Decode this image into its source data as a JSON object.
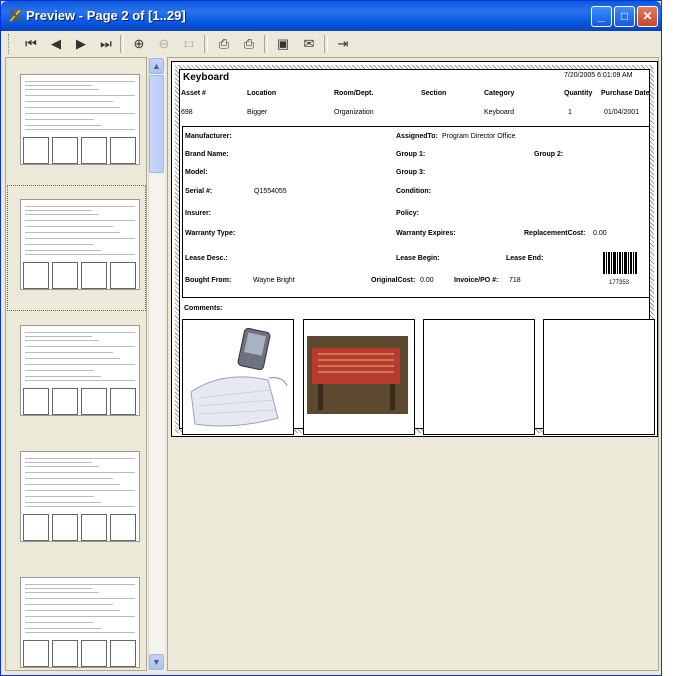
{
  "window": {
    "title": "Preview - Page 2 of [1..29]"
  },
  "toolbar": {
    "buttons": [
      {
        "name": "first-page-icon",
        "glyph": "⏮",
        "enabled": true
      },
      {
        "name": "prev-page-icon",
        "glyph": "◀",
        "enabled": true
      },
      {
        "name": "next-page-icon",
        "glyph": "▶",
        "enabled": true
      },
      {
        "name": "last-page-icon",
        "glyph": "⏭",
        "enabled": true
      },
      {
        "name": "zoom-in-icon",
        "glyph": "⊕",
        "enabled": true
      },
      {
        "name": "zoom-out-icon",
        "glyph": "⊖",
        "enabled": false
      },
      {
        "name": "actual-size-icon",
        "glyph": "1:1",
        "enabled": false
      },
      {
        "name": "print-icon",
        "glyph": "⎙",
        "enabled": true
      },
      {
        "name": "print-setup-icon",
        "glyph": "⎙",
        "enabled": true
      },
      {
        "name": "save-icon",
        "glyph": "▣",
        "enabled": true
      },
      {
        "name": "email-icon",
        "glyph": "✉",
        "enabled": true
      },
      {
        "name": "exit-icon",
        "glyph": "⇥",
        "enabled": true
      }
    ]
  },
  "report": {
    "asset_type": "Keyboard",
    "timestamp": "7/20/2005 6:01:09 AM",
    "columns": [
      "Asset #",
      "Location",
      "Room/Dept.",
      "Section",
      "Category",
      "Quantity",
      "Purchase Date"
    ],
    "row": [
      "698",
      "Bigger",
      "Organization",
      "",
      "Keyboard",
      "1",
      "01/04/2001"
    ],
    "labels": {
      "manufacturer": "Manufacturer:",
      "brand": "Brand Name:",
      "model": "Model:",
      "serial": "Serial #:",
      "insurer": "Insurer:",
      "warranty_type": "Warranty Type:",
      "lease_desc": "Lease Desc.:",
      "bought_from": "Bought From:",
      "assigned_to": "AssignedTo:",
      "group1": "Group 1:",
      "group2": "Group 2:",
      "group3": "Group 3:",
      "condition": "Condition:",
      "policy": "Policy:",
      "warranty_expires": "Warranty Expires:",
      "replacement_cost": "ReplacementCost:",
      "lease_begin": "Lease Begin:",
      "lease_end": "Lease End:",
      "original_cost": "OriginalCost:",
      "invoice": "Invoice/PO #:",
      "comments": "Comments:"
    },
    "values": {
      "assigned_to": "Program Director Office",
      "serial": "Q1554055",
      "replacement_cost": "0.00",
      "bought_from": "Wayne Bright",
      "original_cost": "0.00",
      "invoice": "718",
      "barcode": "177353"
    }
  },
  "colors": {
    "titlebar": "#0858e2",
    "chrome": "#ece9d8"
  }
}
